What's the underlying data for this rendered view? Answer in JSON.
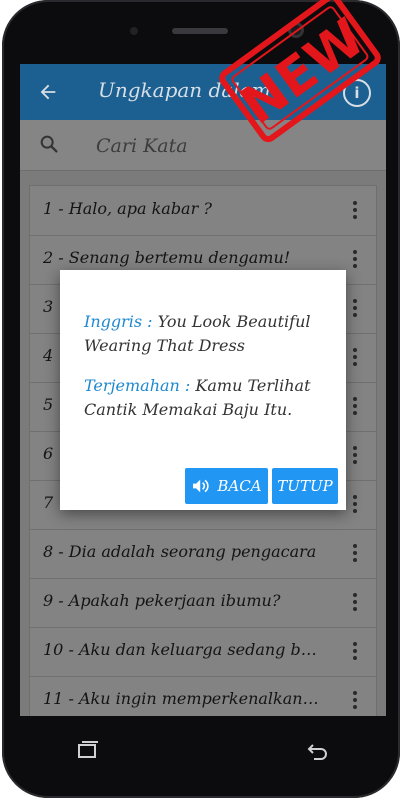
{
  "app": {
    "title": "Ungkapan dalam"
  },
  "search": {
    "placeholder": "Cari Kata"
  },
  "list": {
    "items": [
      {
        "label": "1 - Halo, apa kabar ?"
      },
      {
        "label": "2 - Senang bertemu dengamu!"
      },
      {
        "label": "3"
      },
      {
        "label": "4"
      },
      {
        "label": "5"
      },
      {
        "label": "6"
      },
      {
        "label": "7"
      },
      {
        "label": "8 - Dia adalah seorang pengacara"
      },
      {
        "label": "9 - Apakah pekerjaan ibumu?"
      },
      {
        "label": "10 - Aku dan keluarga sedang be..."
      },
      {
        "label": "11 - Aku ingin memperkenalkan d..."
      }
    ]
  },
  "dialog": {
    "english_label": "Inggris :",
    "english_text": "You Look Beautiful Wearing That Dress",
    "translation_label": "Terjemahan :",
    "translation_text": "Kamu Terlihat Cantik Memakai Baju Itu.",
    "read_button": "BACA",
    "close_button": "TUTUP"
  },
  "badge": {
    "stamp_text": "NEW"
  },
  "colors": {
    "appbar": "#1c5f91",
    "accent": "#2196f3",
    "label_blue": "#1e88d0",
    "stamp_red": "#e3171b"
  }
}
